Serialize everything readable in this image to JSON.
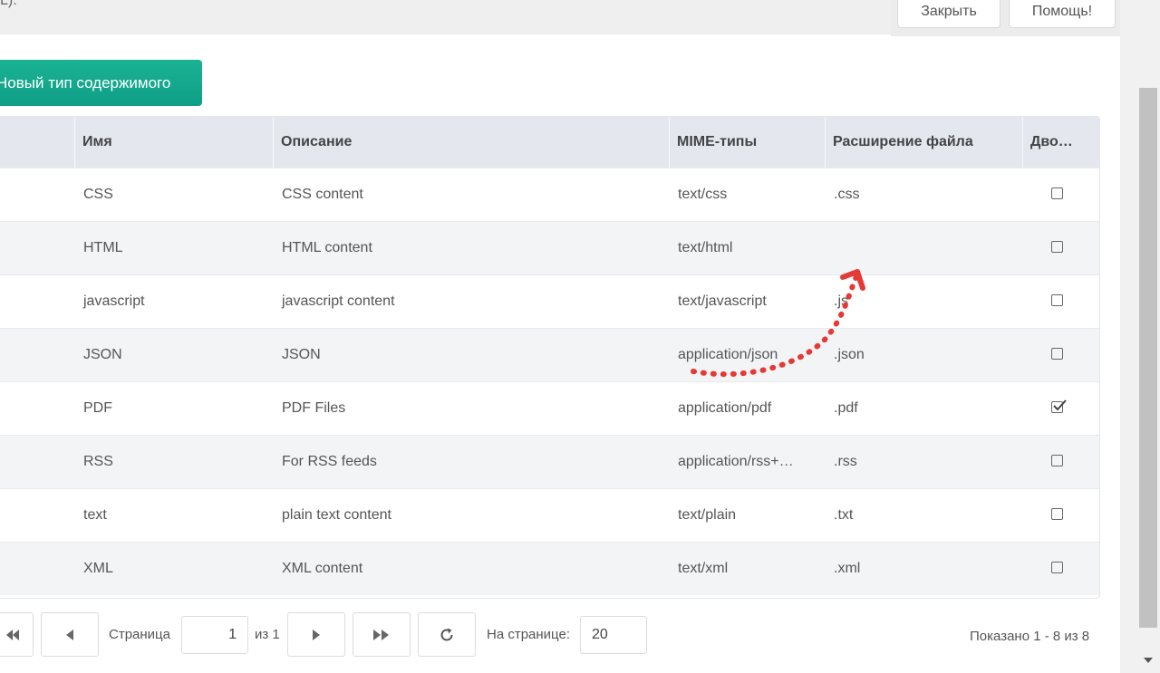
{
  "header": {
    "truncated_text": "L).",
    "close_label": "Закрыть",
    "help_label": "Помощь!"
  },
  "toolbar": {
    "new_type_label": "Новый тип содержимого"
  },
  "table": {
    "columns": [
      "Имя",
      "Описание",
      "MIME-типы",
      "Расширение файла",
      "Дво…"
    ],
    "rows": [
      {
        "name": "CSS",
        "description": "CSS content",
        "mime": "text/css",
        "ext": ".css",
        "binary": false
      },
      {
        "name": "HTML",
        "description": "HTML content",
        "mime": "text/html",
        "ext": "",
        "binary": false
      },
      {
        "name": "javascript",
        "description": "javascript content",
        "mime": "text/javascript",
        "ext": ".js",
        "binary": false
      },
      {
        "name": "JSON",
        "description": "JSON",
        "mime": "application/json",
        "ext": ".json",
        "binary": false
      },
      {
        "name": "PDF",
        "description": "PDF Files",
        "mime": "application/pdf",
        "ext": ".pdf",
        "binary": true
      },
      {
        "name": "RSS",
        "description": "For RSS feeds",
        "mime": "application/rss+…",
        "ext": ".rss",
        "binary": false
      },
      {
        "name": "text",
        "description": "plain text content",
        "mime": "text/plain",
        "ext": ".txt",
        "binary": false
      },
      {
        "name": "XML",
        "description": "XML content",
        "mime": "text/xml",
        "ext": ".xml",
        "binary": false
      }
    ]
  },
  "pager": {
    "page_label": "Страница",
    "page_value": "1",
    "of_label": "из 1",
    "per_page_label": "На странице:",
    "per_page_value": "20",
    "shown_text": "Показано 1 - 8 из 8"
  },
  "colors": {
    "accent": "#1bb394",
    "annotation": "#e53935"
  }
}
